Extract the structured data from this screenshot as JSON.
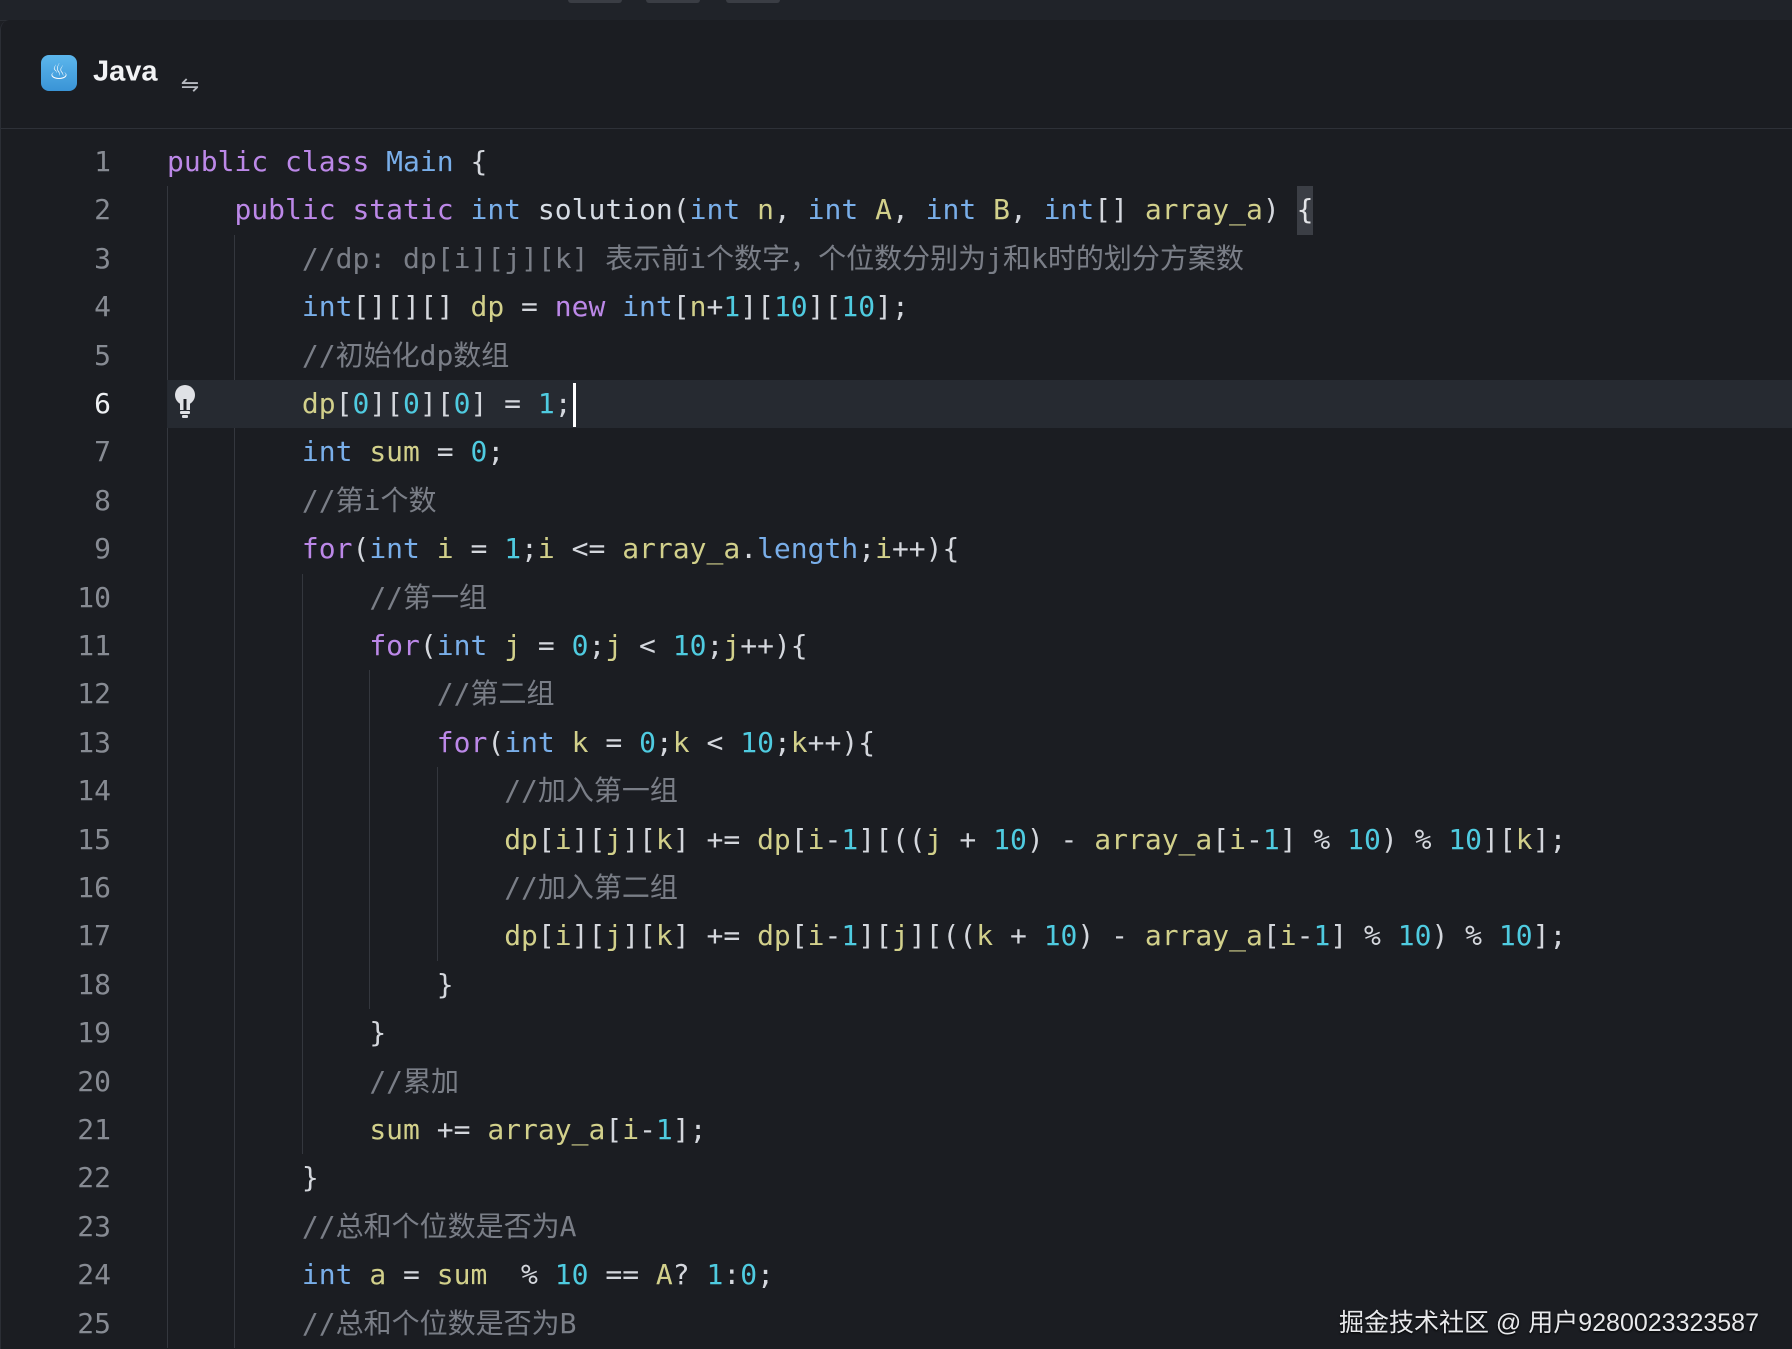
{
  "header": {
    "language": "Java",
    "lang_icon": "java-icon",
    "swap_icon": "swap-arrows-icon"
  },
  "editor": {
    "current_line": 6,
    "lightbulb_icon": "lightbulb-icon",
    "lines": [
      {
        "n": "1",
        "code": "public class Main {"
      },
      {
        "n": "2",
        "code": "    public static int solution(int n, int A, int B, int[] array_a) {"
      },
      {
        "n": "3",
        "code": "        //dp: dp[i][j][k] 表示前i个数字，个位数分别为j和k时的划分方案数"
      },
      {
        "n": "4",
        "code": "        int[][][] dp = new int[n+1][10][10];"
      },
      {
        "n": "5",
        "code": "        //初始化dp数组"
      },
      {
        "n": "6",
        "code": "        dp[0][0][0] = 1;"
      },
      {
        "n": "7",
        "code": "        int sum = 0;"
      },
      {
        "n": "8",
        "code": "        //第i个数"
      },
      {
        "n": "9",
        "code": "        for(int i = 1;i <= array_a.length;i++){"
      },
      {
        "n": "10",
        "code": "            //第一组"
      },
      {
        "n": "11",
        "code": "            for(int j = 0;j < 10;j++){"
      },
      {
        "n": "12",
        "code": "                //第二组"
      },
      {
        "n": "13",
        "code": "                for(int k = 0;k < 10;k++){"
      },
      {
        "n": "14",
        "code": "                    //加入第一组"
      },
      {
        "n": "15",
        "code": "                    dp[i][j][k] += dp[i-1][((j + 10) - array_a[i-1] % 10) % 10][k];"
      },
      {
        "n": "16",
        "code": "                    //加入第二组"
      },
      {
        "n": "17",
        "code": "                    dp[i][j][k] += dp[i-1][j][((k + 10) - array_a[i-1] % 10) % 10];"
      },
      {
        "n": "18",
        "code": "                }"
      },
      {
        "n": "19",
        "code": "            }"
      },
      {
        "n": "20",
        "code": "            //累加"
      },
      {
        "n": "21",
        "code": "            sum += array_a[i-1];"
      },
      {
        "n": "22",
        "code": "        }"
      },
      {
        "n": "23",
        "code": "        //总和个位数是否为A"
      },
      {
        "n": "24",
        "code": "        int a = sum  % 10 == A? 1:0;"
      },
      {
        "n": "25",
        "code": "        //总和个位数是否为B"
      }
    ]
  },
  "watermark": "掘金技术社区 @ 用户9280023323587",
  "colors": {
    "background": "#1b1d22",
    "keyword": "#bc88e8",
    "type": "#79aee9",
    "identifier": "#d2d08b",
    "number": "#4fcbe0",
    "comment": "#7a7e87"
  }
}
